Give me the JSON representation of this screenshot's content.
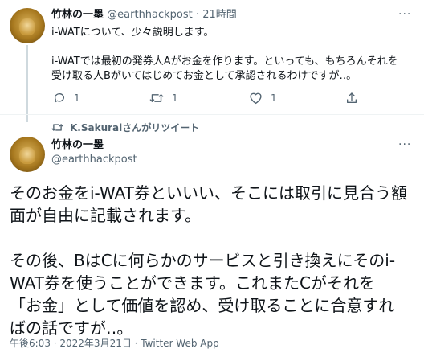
{
  "tweet1": {
    "name": "竹林の一墨",
    "handle": "@earthhackpost",
    "separator": "·",
    "time": "21時間",
    "lines": [
      "i-WATについて、少々説明します。",
      "",
      "i-WATでは最初の発券人Aがお金を作ります。といっても、もちろんそれを",
      "受け取る人Bがいてはじめてお金として承認されるわけですが‥。"
    ],
    "more": "···",
    "actions": {
      "reply_count": "1",
      "retweet_count": "1",
      "like_count": "1"
    }
  },
  "retweet_banner": {
    "text": "K.Sakuraiさんがリツイート"
  },
  "tweet2": {
    "name": "竹林の一墨",
    "handle": "@earthhackpost",
    "more": "···",
    "lines": [
      "そのお金をi-WAT券といいい、そこには取引に見合う額",
      "面が自由に記載されます。",
      "",
      "その後、BはCに何らかのサービスと引き換えにそのi-",
      "WAT券を使うことができます。これまたCがそれを",
      "「お金」として価値を認め、受け取ることに合意すれ",
      "ばの話ですが‥。"
    ],
    "timestamp": "午後6:03 · 2022年3月21日 · Twitter Web App"
  }
}
